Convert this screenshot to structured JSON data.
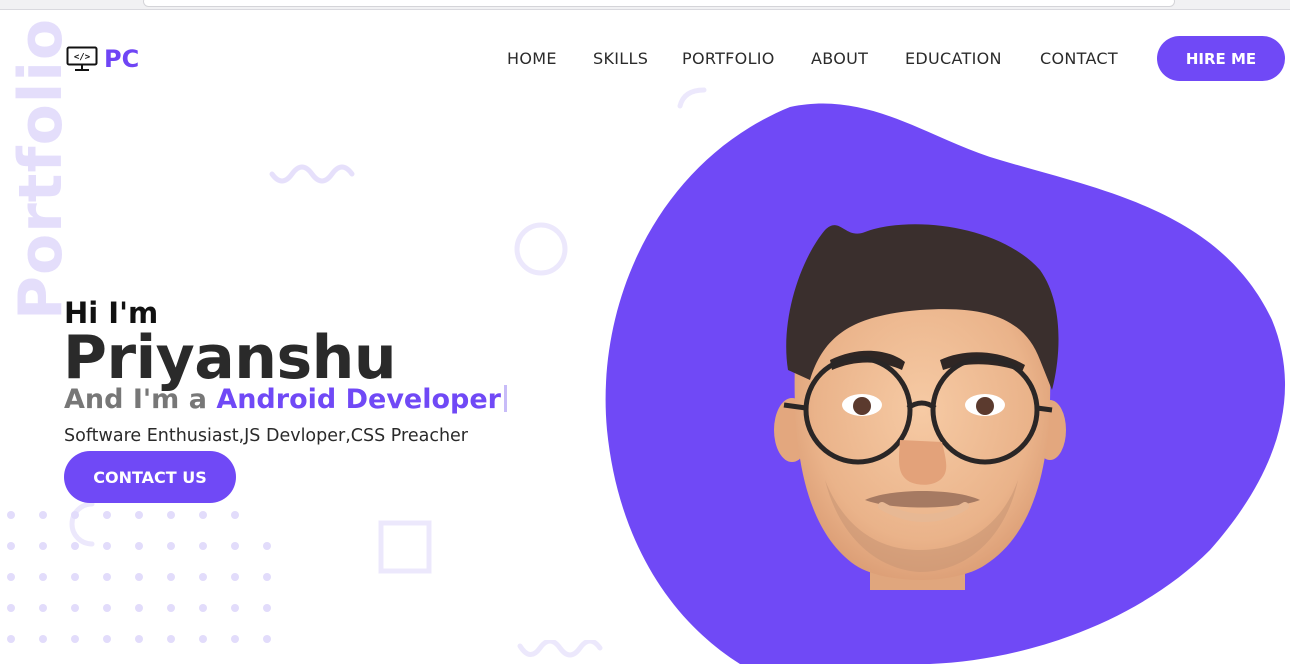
{
  "brand": {
    "name": "PC",
    "icon": "code-monitor-icon"
  },
  "watermark": "Portfolio",
  "nav": {
    "items": [
      "HOME",
      "SKILLS",
      "PORTFOLIO",
      "ABOUT",
      "EDUCATION",
      "CONTACT"
    ],
    "cta": "HIRE ME"
  },
  "hero": {
    "greeting": "Hi I'm",
    "name": "Priyanshu",
    "role_prefix": "And I'm a ",
    "role_highlight": "Android Developer",
    "tagline": "Software Enthusiast,JS Devloper,CSS Preacher",
    "cta": "CONTACT US"
  },
  "colors": {
    "accent": "#7049f6",
    "watermark": "#e4defb",
    "decor": "#ece8fc"
  },
  "illustration": {
    "blob": "purple-blob",
    "avatar": "memoji-avatar-glasses"
  }
}
